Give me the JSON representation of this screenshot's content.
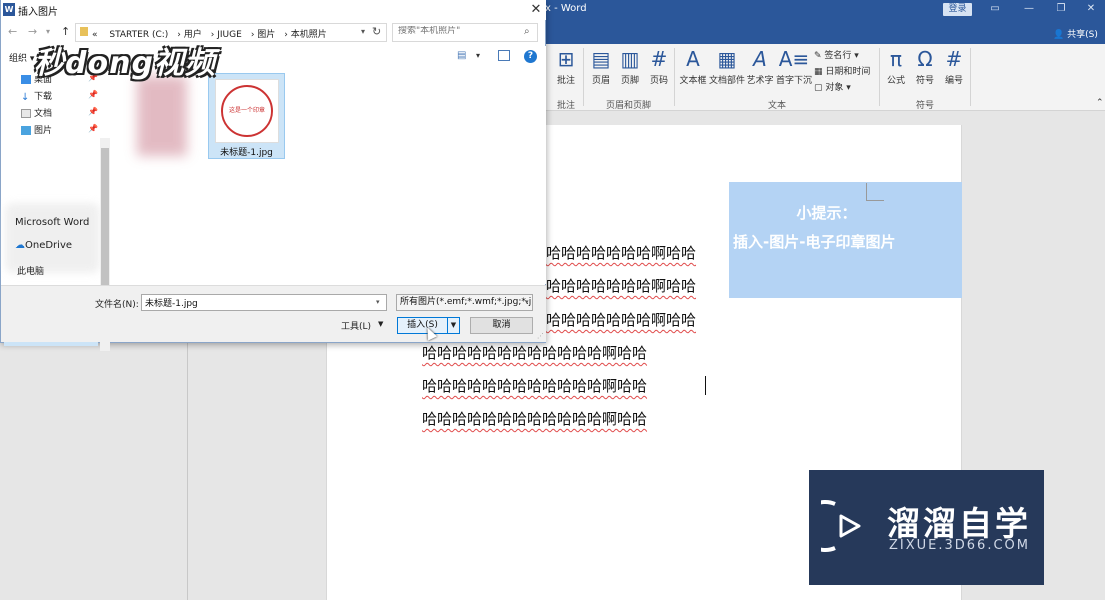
{
  "word": {
    "title": "x - Word",
    "login_label": "登录",
    "share_label": "共享(S)",
    "window_controls": [
      "restore-icon",
      "minimize-icon",
      "maximize-icon",
      "close-icon"
    ]
  },
  "ribbon": {
    "buttons": [
      {
        "label": "批注",
        "icon": "comment-icon"
      },
      {
        "label": "页眉",
        "icon": "header-icon"
      },
      {
        "label": "页脚",
        "icon": "footer-icon"
      },
      {
        "label": "页码",
        "icon": "page-number-icon"
      },
      {
        "label": "文本框",
        "icon": "textbox-icon"
      },
      {
        "label": "文档部件",
        "icon": "quick-parts-icon"
      },
      {
        "label": "艺术字",
        "icon": "wordart-icon"
      },
      {
        "label": "首字下沉",
        "icon": "dropcap-icon"
      },
      {
        "label": "公式",
        "icon": "equation-icon"
      },
      {
        "label": "符号",
        "icon": "symbol-icon"
      },
      {
        "label": "编号",
        "icon": "number-icon"
      }
    ],
    "small_buttons": [
      "签名行",
      "日期和时间",
      "对象"
    ],
    "groups": [
      "批注",
      "页眉和页脚",
      "文本",
      "符号"
    ]
  },
  "document": {
    "tip_title": "小提示：",
    "tip_body": "插入-图片-电子印章图片",
    "lines": [
      "哈哈哈哈哈哈哈哈哈哈哈哈啊哈哈",
      "哈哈哈哈哈哈哈哈哈哈哈哈啊哈哈",
      "哈哈哈哈哈哈哈哈哈哈哈哈啊哈哈",
      "哈哈哈哈哈哈哈哈哈哈哈哈啊哈哈",
      "哈哈哈哈哈哈哈哈哈哈哈哈啊哈哈",
      "哈哈哈哈哈哈哈哈哈哈哈哈啊哈哈"
    ],
    "visible_fragment": "哈哈哈哈哈哈哈啊哈哈"
  },
  "dialog": {
    "title": "插入图片",
    "path": [
      "«",
      "STARTER (C:)",
      "用户",
      "JIUGE",
      "图片",
      "本机照片"
    ],
    "search_placeholder": "搜索\"本机照片\"",
    "organize_label": "组织 ▾",
    "nav_items": [
      "桌面",
      "下载",
      "文档",
      "图片"
    ],
    "nav_big_items": [
      "Microsoft Word",
      "OneDrive",
      "此电脑"
    ],
    "file_name_label": "文件名(N):",
    "file_name_value": "未标题-1.jpg",
    "file_type_value": "所有图片(*.emf;*.wmf;*.jpg;*.j",
    "tools_label": "工具(L)",
    "insert_label": "插入(S)",
    "cancel_label": "取消",
    "files": [
      {
        "name": "未标题-1.jpg",
        "stamp_text": "这是一个印章",
        "selected": true
      }
    ]
  },
  "watermarks": {
    "video": "秒dong视频",
    "brand_name": "溜溜自学",
    "brand_sub": "ZIXUE.3D66.COM"
  },
  "colors": {
    "word_blue": "#2b579a",
    "tip_bg": "#b4d3f4",
    "stamp_red": "#cc3333",
    "brand_bg": "#26395a"
  }
}
